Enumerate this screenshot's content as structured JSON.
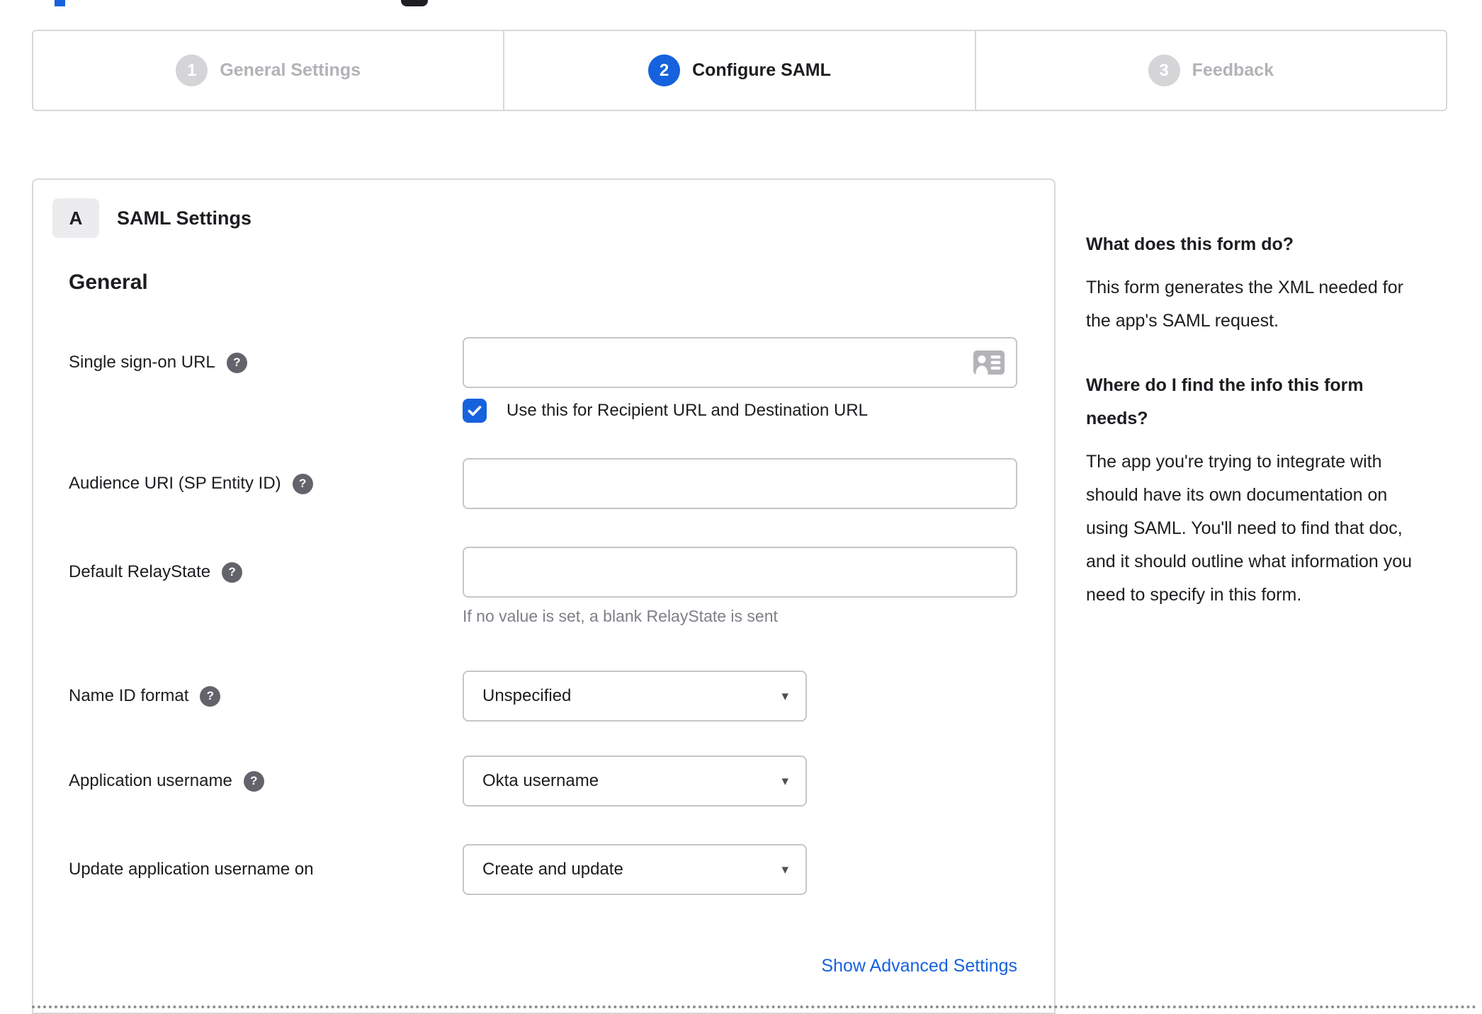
{
  "stepper": {
    "steps": [
      {
        "number": "1",
        "label": "General Settings",
        "state": "inactive"
      },
      {
        "number": "2",
        "label": "Configure SAML",
        "state": "active"
      },
      {
        "number": "3",
        "label": "Feedback",
        "state": "inactive"
      }
    ]
  },
  "panel": {
    "badge": "A",
    "title": "SAML Settings",
    "section_heading": "General",
    "fields": [
      {
        "label": "Single sign-on URL",
        "type": "text",
        "value": "",
        "checkbox": {
          "checked": true,
          "label": "Use this for Recipient URL and Destination URL"
        }
      },
      {
        "label": "Audience URI (SP Entity ID)",
        "type": "text",
        "value": ""
      },
      {
        "label": "Default RelayState",
        "type": "text",
        "value": "",
        "helper": "If no value is set, a blank RelayState is sent"
      },
      {
        "label": "Name ID format",
        "type": "select",
        "value": "Unspecified"
      },
      {
        "label": "Application username",
        "type": "select",
        "value": "Okta username"
      },
      {
        "label": "Update application username on",
        "type": "select",
        "value": "Create and update"
      }
    ],
    "advanced_link": "Show Advanced Settings"
  },
  "sidebar": {
    "sections": [
      {
        "heading": "What does this form do?",
        "body": "This form generates the XML needed for the app's SAML request."
      },
      {
        "heading": "Where do I find the info this form needs?",
        "body": "The app you're trying to integrate with should have its own documentation on using SAML. You'll need to find that doc, and it should outline what information you need to specify in this form."
      }
    ]
  },
  "icons": {
    "help": "?",
    "caret": "▾",
    "check": "✓"
  },
  "colors": {
    "accent_blue": "#1662dd",
    "text_dark": "#1d1d21",
    "inactive_gray": "#b2b2b7",
    "border_gray": "#d8d8da",
    "helper_gray": "#7f7f88"
  }
}
